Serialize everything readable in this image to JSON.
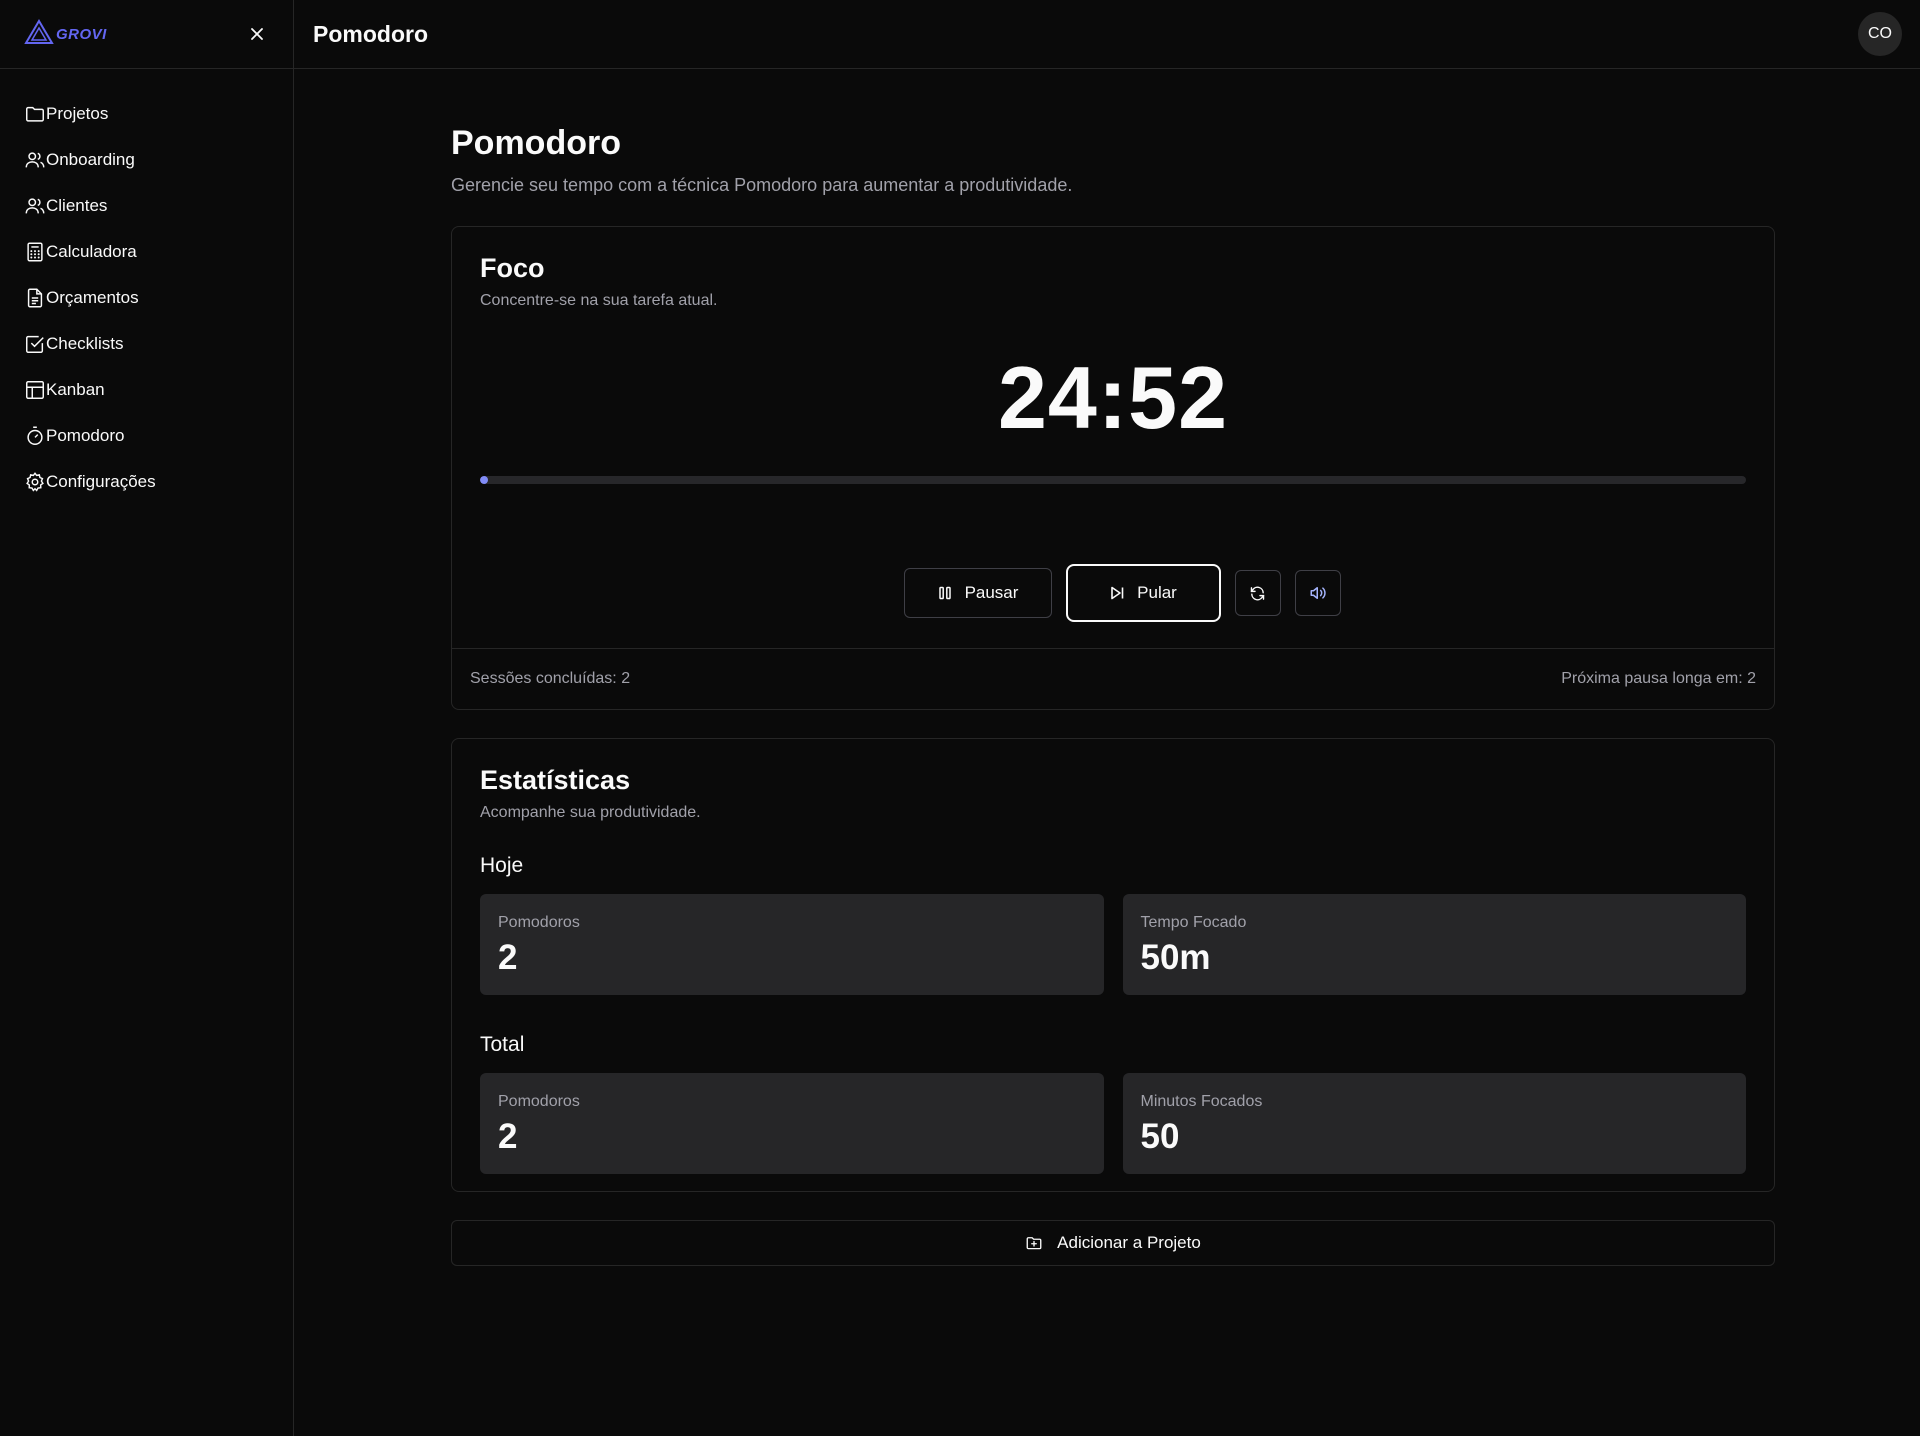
{
  "brand": {
    "name": "GROVI",
    "accent": "#6366f1"
  },
  "sidebar": {
    "items": [
      {
        "label": "Projetos",
        "icon": "folder-icon"
      },
      {
        "label": "Onboarding",
        "icon": "users-icon"
      },
      {
        "label": "Clientes",
        "icon": "users-icon"
      },
      {
        "label": "Calculadora",
        "icon": "calculator-icon"
      },
      {
        "label": "Orçamentos",
        "icon": "file-text-icon"
      },
      {
        "label": "Checklists",
        "icon": "check-square-icon"
      },
      {
        "label": "Kanban",
        "icon": "layout-icon"
      },
      {
        "label": "Pomodoro",
        "icon": "timer-icon"
      },
      {
        "label": "Configurações",
        "icon": "settings-icon"
      }
    ]
  },
  "header": {
    "title": "Pomodoro",
    "avatar": "CO"
  },
  "page": {
    "title": "Pomodoro",
    "subtitle": "Gerencie seu tempo com a técnica Pomodoro para aumentar a produtividade."
  },
  "focus": {
    "title": "Foco",
    "subtitle": "Concentre-se na sua tarefa atual.",
    "timer": "24:52",
    "progress_fraction": 0.004,
    "pause_label": "Pausar",
    "skip_label": "Pular",
    "sessions_done": "Sessões concluídas: 2",
    "next_long_break": "Próxima pausa longa em: 2"
  },
  "stats": {
    "title": "Estatísticas",
    "subtitle": "Acompanhe sua produtividade.",
    "today": {
      "label": "Hoje",
      "pomodoros_label": "Pomodoros",
      "pomodoros_value": "2",
      "time_label": "Tempo Focado",
      "time_value": "50m"
    },
    "total": {
      "label": "Total",
      "pomodoros_label": "Pomodoros",
      "pomodoros_value": "2",
      "minutes_label": "Minutos Focados",
      "minutes_value": "50"
    }
  },
  "add_to_project_label": "Adicionar a Projeto"
}
